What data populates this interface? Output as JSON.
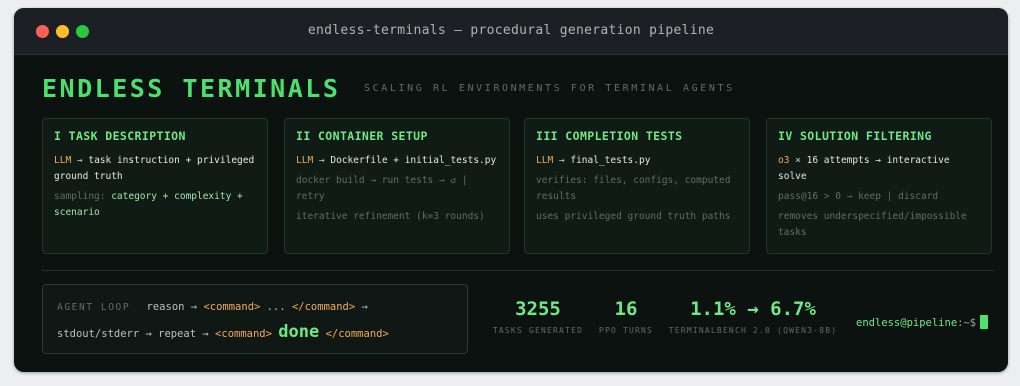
{
  "window": {
    "title": "endless-terminals — procedural generation pipeline"
  },
  "header": {
    "title": "ENDLESS TERMINALS",
    "subtitle": "SCALING RL ENVIRONMENTS FOR TERMINAL AGENTS"
  },
  "stages": [
    {
      "title": "I TASK DESCRIPTION",
      "highlight": "LLM",
      "arrow": " → ",
      "rest": "task instruction + privileged ground truth",
      "lines": [
        {
          "prefix": "sampling: ",
          "accent": "category + complexity + scenario"
        }
      ]
    },
    {
      "title": "II CONTAINER SETUP",
      "highlight": "LLM",
      "arrow": " → ",
      "rest": "Dockerfile + initial_tests.py",
      "lines": [
        {
          "prefix": "docker build → run tests → ↺ | retry",
          "accent": ""
        },
        {
          "prefix": "iterative refinement (k=3 rounds)",
          "accent": ""
        }
      ]
    },
    {
      "title": "III COMPLETION TESTS",
      "highlight": "LLM",
      "arrow": " → ",
      "rest": "final_tests.py",
      "lines": [
        {
          "prefix": "verifies: files, configs, computed results",
          "accent": ""
        },
        {
          "prefix": "uses privileged ground truth paths",
          "accent": ""
        }
      ]
    },
    {
      "title": "IV SOLUTION FILTERING",
      "highlight": "o3",
      "arrow": " × ",
      "rest": "16 attempts → interactive solve",
      "lines": [
        {
          "prefix": "pass@16 > 0 → keep | discard",
          "accent": ""
        },
        {
          "prefix": "removes underspecified/impossible tasks",
          "accent": ""
        }
      ]
    }
  ],
  "agent_loop": {
    "label": "AGENT LOOP",
    "reason": "reason →",
    "cmd_open": "<command>",
    "ellipsis": "...",
    "cmd_close": "</command>",
    "arrow": "→",
    "stdout": "stdout/stderr → repeat →",
    "cmd_open2": "<command>",
    "done": "done",
    "cmd_close2": "</command>"
  },
  "stats": [
    {
      "value": "3255",
      "label": "TASKS GENERATED"
    },
    {
      "value": "16",
      "label": "PPO TURNS"
    },
    {
      "value": "1.1% → 6.7%",
      "label": "TERMINALBENCH 2.0 (QWEN3-8B)"
    }
  ],
  "prompt": {
    "user": "endless@pipeline",
    "suffix": ":~$"
  },
  "colors": {
    "accent": "#4ee06c",
    "highlight": "#f3a95a",
    "background": "#0c1210"
  }
}
